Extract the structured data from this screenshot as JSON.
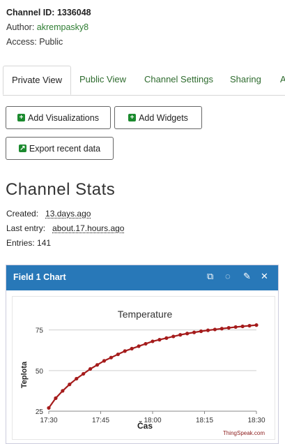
{
  "channel": {
    "id_label": "Channel ID:",
    "id_value": "1336048",
    "author_label": "Author:",
    "author_value": "akrempasky8",
    "access_label": "Access:",
    "access_value": "Public"
  },
  "tabs": [
    {
      "label": "Private View",
      "active": true
    },
    {
      "label": "Public View"
    },
    {
      "label": "Channel Settings"
    },
    {
      "label": "Sharing"
    },
    {
      "label": "A"
    }
  ],
  "buttons": {
    "add_visualizations": "Add Visualizations",
    "add_widgets": "Add Widgets",
    "export_recent_data": "Export recent data"
  },
  "stats": {
    "heading": "Channel Stats",
    "created_label": "Created:",
    "created_value": "13.days.ago",
    "last_entry_label": "Last entry:",
    "last_entry_value": "about.17.hours.ago",
    "entries_label": "Entries:",
    "entries_value": "141"
  },
  "card": {
    "title": "Field 1 Chart",
    "header_bg": "#2878b8",
    "icons": [
      "external-link-icon",
      "comment-icon",
      "pencil-icon",
      "close-icon"
    ],
    "watermark": "ThingSpeak.com"
  },
  "chart_data": {
    "type": "line",
    "title": "Temperature",
    "xlabel": "Čas",
    "ylabel": "Teplota",
    "xlim": [
      "17:30",
      "18:30"
    ],
    "ylim": [
      25,
      80
    ],
    "x_ticks": [
      "17:30",
      "17:45",
      "18:00",
      "18:15",
      "18:30"
    ],
    "y_ticks": [
      25,
      50,
      75
    ],
    "grid": true,
    "color": "#a51c1c",
    "series": [
      {
        "x": [
          "17:30",
          "17:32",
          "17:34",
          "17:36",
          "17:38",
          "17:40",
          "17:42",
          "17:44",
          "17:46",
          "17:48",
          "17:50",
          "17:52",
          "17:54",
          "17:56",
          "17:58",
          "18:00",
          "18:02",
          "18:04",
          "18:06",
          "18:08",
          "18:10",
          "18:12",
          "18:14",
          "18:16",
          "18:18",
          "18:20",
          "18:22",
          "18:24",
          "18:26",
          "18:28",
          "18:30"
        ],
        "y": [
          27,
          33,
          37.5,
          41.5,
          45,
          48,
          51,
          53.5,
          56,
          58,
          60,
          62,
          63.5,
          65,
          66.5,
          68,
          69,
          70,
          71,
          72,
          72.8,
          73.5,
          74.2,
          74.8,
          75.3,
          75.8,
          76.3,
          76.8,
          77.2,
          77.6,
          78
        ]
      }
    ]
  }
}
